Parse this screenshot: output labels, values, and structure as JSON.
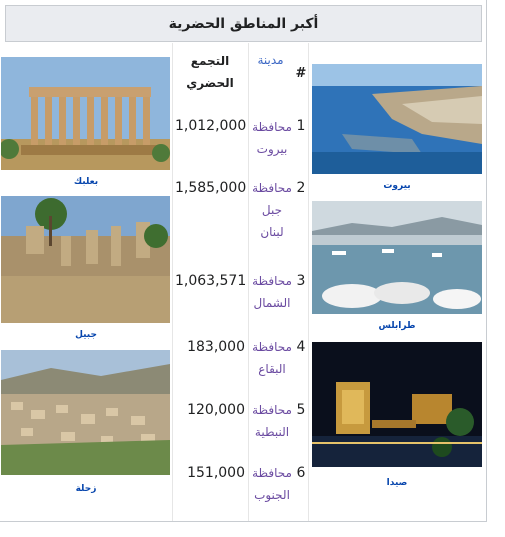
{
  "table": {
    "caption": "أكبر المناطق الحضرية",
    "headers": {
      "number": "#",
      "city": "مدينة",
      "population": "التجمع الحضري"
    },
    "rows": [
      {
        "rank": "1",
        "governorate": "محافظة بيروت",
        "population": "1,012,000"
      },
      {
        "rank": "2",
        "governorate": "محافظة جبل لبنان",
        "population": "1,585,000"
      },
      {
        "rank": "3",
        "governorate": "محافظة الشمال",
        "population": "1,063,571"
      },
      {
        "rank": "4",
        "governorate": "محافظة البقاع",
        "population": "183,000"
      },
      {
        "rank": "5",
        "governorate": "محافظة النبطية",
        "population": "120,000"
      },
      {
        "rank": "6",
        "governorate": "محافظة الجنوب",
        "population": "151,000"
      }
    ]
  },
  "images": {
    "right": [
      {
        "caption": "بيروت"
      },
      {
        "caption": "طرابلس"
      },
      {
        "caption": "صيدا"
      }
    ],
    "left": [
      {
        "caption": "بعلبك"
      },
      {
        "caption": "جبيل"
      },
      {
        "caption": "زحلة"
      }
    ]
  },
  "colors": {
    "link": "#0645ad",
    "visited_link": "#6b4ba1",
    "header_bg": "#eaecf0",
    "border": "#c8ccd1"
  }
}
